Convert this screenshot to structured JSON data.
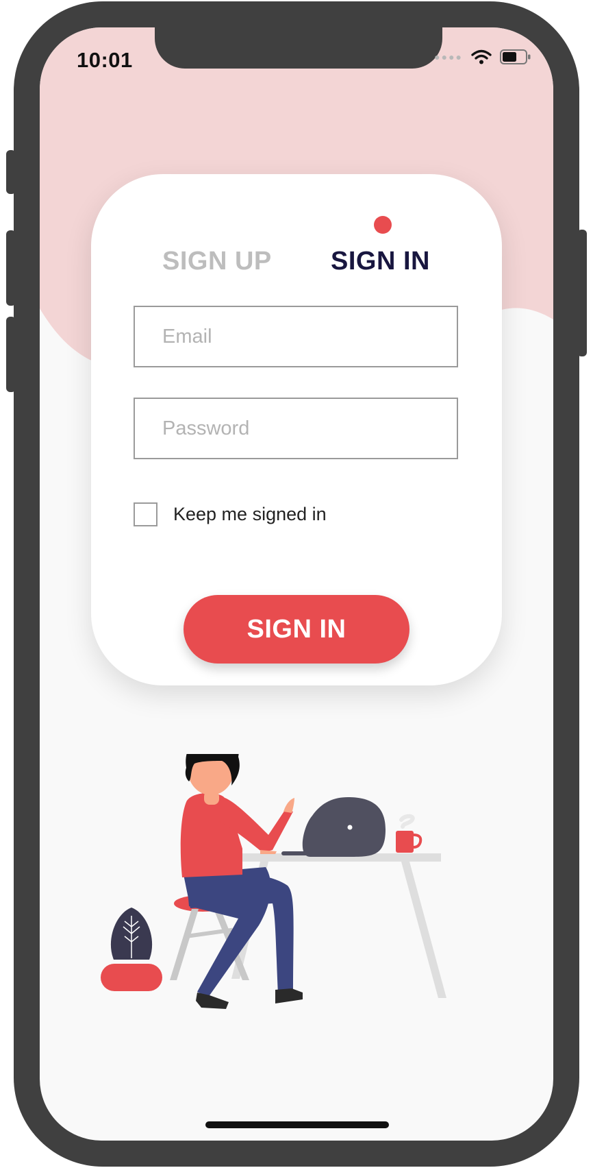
{
  "status_bar": {
    "time": "10:01",
    "signal_icon": "signal-dots-icon",
    "wifi_icon": "wifi-icon",
    "battery_icon": "battery-icon"
  },
  "auth": {
    "tabs": [
      {
        "label": "SIGN UP",
        "active": false
      },
      {
        "label": "SIGN IN",
        "active": true
      }
    ],
    "email": {
      "placeholder": "Email",
      "value": ""
    },
    "password": {
      "placeholder": "Password",
      "value": ""
    },
    "remember_label": "Keep me signed in",
    "remember_checked": false,
    "submit_label": "SIGN IN"
  },
  "colors": {
    "accent": "#e84c4f",
    "header_bg": "#f3d5d5",
    "active_tab": "#18163f",
    "inactive_tab": "#bdbdbd",
    "screen_bg": "#f9f9f9"
  },
  "illustration": {
    "subject": "person-at-desk-with-laptop-illustration"
  }
}
